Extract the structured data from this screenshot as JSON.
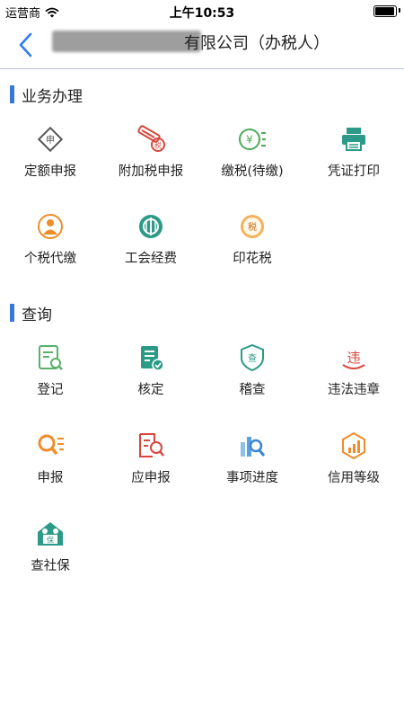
{
  "status_bar": {
    "carrier": "运营商",
    "time": "上午10:53"
  },
  "nav": {
    "title": "有限公司（办税人）"
  },
  "sections": {
    "business": {
      "title": "业务办理",
      "items": [
        {
          "label": "定额申报",
          "icon": "declare-diamond-icon"
        },
        {
          "label": "附加税申报",
          "icon": "pen-tax-icon"
        },
        {
          "label": "缴税(待缴)",
          "icon": "yen-coin-icon"
        },
        {
          "label": "凭证打印",
          "icon": "printer-icon"
        },
        {
          "label": "个税代缴",
          "icon": "personal-tax-icon"
        },
        {
          "label": "工会经费",
          "icon": "union-badge-icon"
        },
        {
          "label": "印花税",
          "icon": "stamp-tax-icon"
        }
      ]
    },
    "query": {
      "title": "查询",
      "items": [
        {
          "label": "登记",
          "icon": "register-doc-icon"
        },
        {
          "label": "核定",
          "icon": "verified-doc-icon"
        },
        {
          "label": "稽查",
          "icon": "inspection-shield-icon"
        },
        {
          "label": "违法违章",
          "icon": "violation-icon"
        },
        {
          "label": "申报",
          "icon": "search-list-icon"
        },
        {
          "label": "应申报",
          "icon": "due-declare-icon"
        },
        {
          "label": "事项进度",
          "icon": "progress-chart-icon"
        },
        {
          "label": "信用等级",
          "icon": "credit-level-icon"
        },
        {
          "label": "查社保",
          "icon": "social-security-icon"
        }
      ]
    }
  },
  "colors": {
    "accent": "#3a78d8",
    "divider": "#b9b9df"
  }
}
